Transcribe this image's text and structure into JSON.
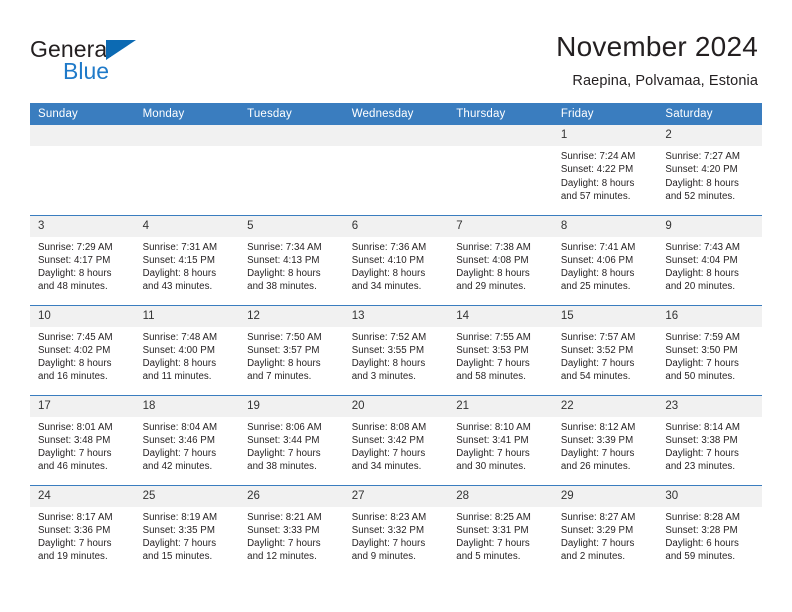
{
  "brand": {
    "name_part1": "General",
    "name_part2": "Blue",
    "logo_icon": "triangle-flag-icon"
  },
  "header": {
    "title": "November 2024",
    "subtitle": "Raepina, Polvamaa, Estonia"
  },
  "colors": {
    "header_blue": "#3a7dbf",
    "logo_blue": "#1f7ac9",
    "daynum_band": "#f1f1f1",
    "text": "#231f20"
  },
  "weekdays": [
    "Sunday",
    "Monday",
    "Tuesday",
    "Wednesday",
    "Thursday",
    "Friday",
    "Saturday"
  ],
  "labels": {
    "sunrise": "Sunrise:",
    "sunset": "Sunset:",
    "daylight": "Daylight:"
  },
  "weeks": [
    [
      {
        "day": "",
        "blank": true
      },
      {
        "day": "",
        "blank": true
      },
      {
        "day": "",
        "blank": true
      },
      {
        "day": "",
        "blank": true
      },
      {
        "day": "",
        "blank": true
      },
      {
        "day": "1",
        "sunrise": "Sunrise: 7:24 AM",
        "sunset": "Sunset: 4:22 PM",
        "daylight1": "Daylight: 8 hours",
        "daylight2": "and 57 minutes."
      },
      {
        "day": "2",
        "sunrise": "Sunrise: 7:27 AM",
        "sunset": "Sunset: 4:20 PM",
        "daylight1": "Daylight: 8 hours",
        "daylight2": "and 52 minutes."
      }
    ],
    [
      {
        "day": "3",
        "sunrise": "Sunrise: 7:29 AM",
        "sunset": "Sunset: 4:17 PM",
        "daylight1": "Daylight: 8 hours",
        "daylight2": "and 48 minutes."
      },
      {
        "day": "4",
        "sunrise": "Sunrise: 7:31 AM",
        "sunset": "Sunset: 4:15 PM",
        "daylight1": "Daylight: 8 hours",
        "daylight2": "and 43 minutes."
      },
      {
        "day": "5",
        "sunrise": "Sunrise: 7:34 AM",
        "sunset": "Sunset: 4:13 PM",
        "daylight1": "Daylight: 8 hours",
        "daylight2": "and 38 minutes."
      },
      {
        "day": "6",
        "sunrise": "Sunrise: 7:36 AM",
        "sunset": "Sunset: 4:10 PM",
        "daylight1": "Daylight: 8 hours",
        "daylight2": "and 34 minutes."
      },
      {
        "day": "7",
        "sunrise": "Sunrise: 7:38 AM",
        "sunset": "Sunset: 4:08 PM",
        "daylight1": "Daylight: 8 hours",
        "daylight2": "and 29 minutes."
      },
      {
        "day": "8",
        "sunrise": "Sunrise: 7:41 AM",
        "sunset": "Sunset: 4:06 PM",
        "daylight1": "Daylight: 8 hours",
        "daylight2": "and 25 minutes."
      },
      {
        "day": "9",
        "sunrise": "Sunrise: 7:43 AM",
        "sunset": "Sunset: 4:04 PM",
        "daylight1": "Daylight: 8 hours",
        "daylight2": "and 20 minutes."
      }
    ],
    [
      {
        "day": "10",
        "sunrise": "Sunrise: 7:45 AM",
        "sunset": "Sunset: 4:02 PM",
        "daylight1": "Daylight: 8 hours",
        "daylight2": "and 16 minutes."
      },
      {
        "day": "11",
        "sunrise": "Sunrise: 7:48 AM",
        "sunset": "Sunset: 4:00 PM",
        "daylight1": "Daylight: 8 hours",
        "daylight2": "and 11 minutes."
      },
      {
        "day": "12",
        "sunrise": "Sunrise: 7:50 AM",
        "sunset": "Sunset: 3:57 PM",
        "daylight1": "Daylight: 8 hours",
        "daylight2": "and 7 minutes."
      },
      {
        "day": "13",
        "sunrise": "Sunrise: 7:52 AM",
        "sunset": "Sunset: 3:55 PM",
        "daylight1": "Daylight: 8 hours",
        "daylight2": "and 3 minutes."
      },
      {
        "day": "14",
        "sunrise": "Sunrise: 7:55 AM",
        "sunset": "Sunset: 3:53 PM",
        "daylight1": "Daylight: 7 hours",
        "daylight2": "and 58 minutes."
      },
      {
        "day": "15",
        "sunrise": "Sunrise: 7:57 AM",
        "sunset": "Sunset: 3:52 PM",
        "daylight1": "Daylight: 7 hours",
        "daylight2": "and 54 minutes."
      },
      {
        "day": "16",
        "sunrise": "Sunrise: 7:59 AM",
        "sunset": "Sunset: 3:50 PM",
        "daylight1": "Daylight: 7 hours",
        "daylight2": "and 50 minutes."
      }
    ],
    [
      {
        "day": "17",
        "sunrise": "Sunrise: 8:01 AM",
        "sunset": "Sunset: 3:48 PM",
        "daylight1": "Daylight: 7 hours",
        "daylight2": "and 46 minutes."
      },
      {
        "day": "18",
        "sunrise": "Sunrise: 8:04 AM",
        "sunset": "Sunset: 3:46 PM",
        "daylight1": "Daylight: 7 hours",
        "daylight2": "and 42 minutes."
      },
      {
        "day": "19",
        "sunrise": "Sunrise: 8:06 AM",
        "sunset": "Sunset: 3:44 PM",
        "daylight1": "Daylight: 7 hours",
        "daylight2": "and 38 minutes."
      },
      {
        "day": "20",
        "sunrise": "Sunrise: 8:08 AM",
        "sunset": "Sunset: 3:42 PM",
        "daylight1": "Daylight: 7 hours",
        "daylight2": "and 34 minutes."
      },
      {
        "day": "21",
        "sunrise": "Sunrise: 8:10 AM",
        "sunset": "Sunset: 3:41 PM",
        "daylight1": "Daylight: 7 hours",
        "daylight2": "and 30 minutes."
      },
      {
        "day": "22",
        "sunrise": "Sunrise: 8:12 AM",
        "sunset": "Sunset: 3:39 PM",
        "daylight1": "Daylight: 7 hours",
        "daylight2": "and 26 minutes."
      },
      {
        "day": "23",
        "sunrise": "Sunrise: 8:14 AM",
        "sunset": "Sunset: 3:38 PM",
        "daylight1": "Daylight: 7 hours",
        "daylight2": "and 23 minutes."
      }
    ],
    [
      {
        "day": "24",
        "sunrise": "Sunrise: 8:17 AM",
        "sunset": "Sunset: 3:36 PM",
        "daylight1": "Daylight: 7 hours",
        "daylight2": "and 19 minutes."
      },
      {
        "day": "25",
        "sunrise": "Sunrise: 8:19 AM",
        "sunset": "Sunset: 3:35 PM",
        "daylight1": "Daylight: 7 hours",
        "daylight2": "and 15 minutes."
      },
      {
        "day": "26",
        "sunrise": "Sunrise: 8:21 AM",
        "sunset": "Sunset: 3:33 PM",
        "daylight1": "Daylight: 7 hours",
        "daylight2": "and 12 minutes."
      },
      {
        "day": "27",
        "sunrise": "Sunrise: 8:23 AM",
        "sunset": "Sunset: 3:32 PM",
        "daylight1": "Daylight: 7 hours",
        "daylight2": "and 9 minutes."
      },
      {
        "day": "28",
        "sunrise": "Sunrise: 8:25 AM",
        "sunset": "Sunset: 3:31 PM",
        "daylight1": "Daylight: 7 hours",
        "daylight2": "and 5 minutes."
      },
      {
        "day": "29",
        "sunrise": "Sunrise: 8:27 AM",
        "sunset": "Sunset: 3:29 PM",
        "daylight1": "Daylight: 7 hours",
        "daylight2": "and 2 minutes."
      },
      {
        "day": "30",
        "sunrise": "Sunrise: 8:28 AM",
        "sunset": "Sunset: 3:28 PM",
        "daylight1": "Daylight: 6 hours",
        "daylight2": "and 59 minutes."
      }
    ]
  ]
}
